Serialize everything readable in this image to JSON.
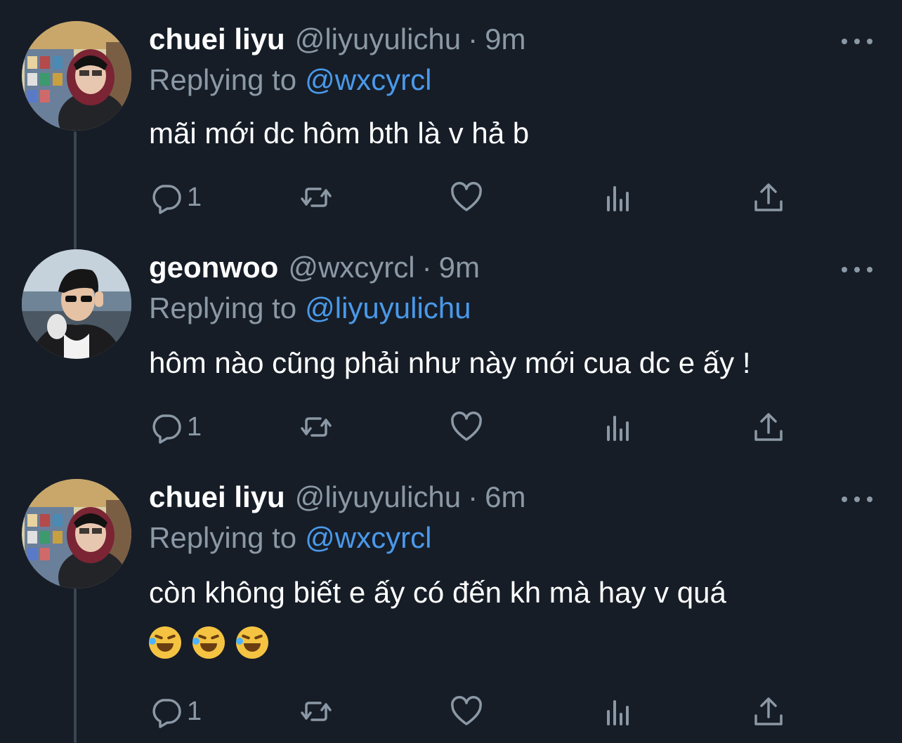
{
  "tweets": [
    {
      "name": "chuei liyu",
      "handle": "@liyuyulichu",
      "separator": "·",
      "time": "9m",
      "replying_label": "Replying to",
      "replying_to": "@wxcyrcl",
      "text": "mãi mới dc hôm bth là v hả b",
      "extra_text": "",
      "reply_count": "1"
    },
    {
      "name": "geonwoo",
      "handle": "@wxcyrcl",
      "separator": "·",
      "time": "9m",
      "replying_label": "Replying to",
      "replying_to": "@liyuyulichu",
      "text": "hôm nào cũng phải như này mới cua dc e ấy !",
      "extra_text": "",
      "reply_count": "1"
    },
    {
      "name": "chuei liyu",
      "handle": "@liyuyulichu",
      "separator": "·",
      "time": "6m",
      "replying_label": "Replying to",
      "replying_to": "@wxcyrcl",
      "text": "còn không biết e ấy có đến kh mà hay v quá",
      "emojis": [
        "rolling-on-floor-laughing-emoji",
        "rolling-on-floor-laughing-emoji",
        "rolling-on-floor-laughing-emoji"
      ],
      "reply_count": "1"
    }
  ],
  "icons": {
    "reply": "reply-icon",
    "retweet": "retweet-icon",
    "like": "heart-icon",
    "views": "views-icon",
    "share": "share-icon",
    "more": "more-icon"
  },
  "colors": {
    "background": "#161d27",
    "muted": "#8b98a5",
    "mention": "#4a99e9",
    "thread_line": "#3a4550"
  }
}
